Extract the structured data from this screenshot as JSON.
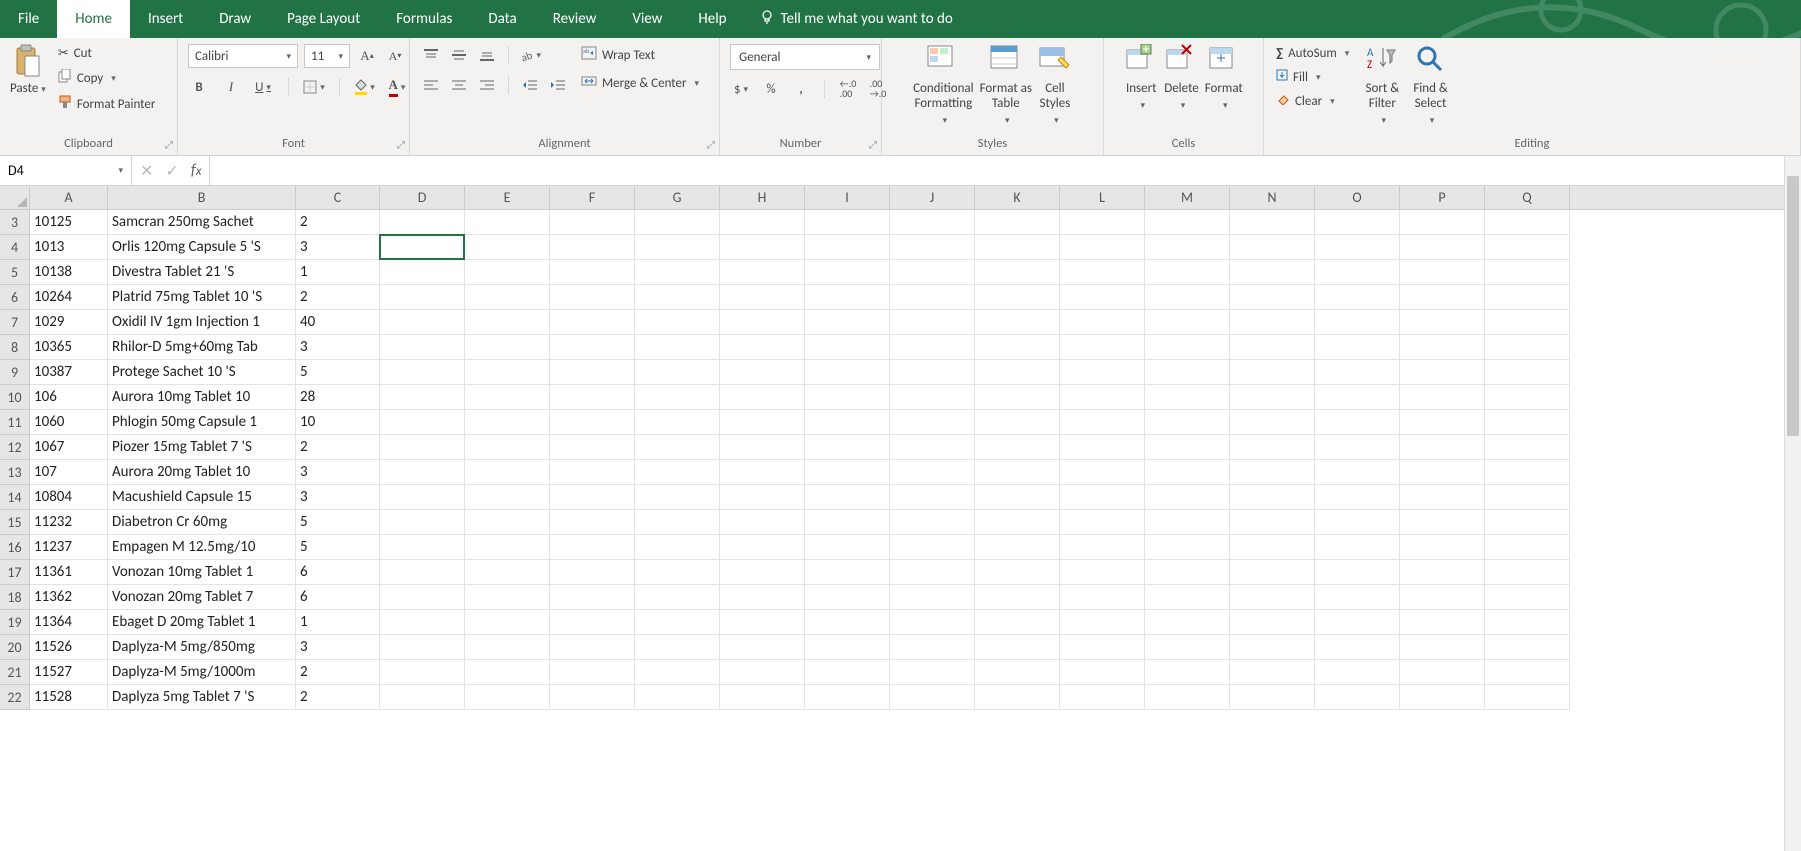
{
  "tabs": {
    "file": "File",
    "home": "Home",
    "insert": "Insert",
    "draw": "Draw",
    "page_layout": "Page Layout",
    "formulas": "Formulas",
    "data": "Data",
    "review": "Review",
    "view": "View",
    "help": "Help",
    "tellme": "Tell me what you want to do"
  },
  "ribbon": {
    "clipboard": {
      "paste": "Paste",
      "cut": "Cut",
      "copy": "Copy",
      "format_painter": "Format Painter",
      "label": "Clipboard"
    },
    "font": {
      "name": "Calibri",
      "size": "11",
      "label": "Font"
    },
    "alignment": {
      "wrap": "Wrap Text",
      "merge": "Merge & Center",
      "label": "Alignment"
    },
    "number": {
      "format": "General",
      "label": "Number"
    },
    "styles": {
      "cond": "Conditional\nFormatting",
      "table": "Format as\nTable",
      "cell": "Cell\nStyles",
      "label": "Styles"
    },
    "cells": {
      "insert": "Insert",
      "delete": "Delete",
      "format": "Format",
      "label": "Cells"
    },
    "editing": {
      "autosum": "AutoSum",
      "fill": "Fill",
      "clear": "Clear",
      "sort": "Sort &\nFilter",
      "find": "Find &\nSelect",
      "label": "Editing"
    }
  },
  "namebox": "D4",
  "formula": "",
  "columns": [
    "A",
    "B",
    "C",
    "D",
    "E",
    "F",
    "G",
    "H",
    "I",
    "J",
    "K",
    "L",
    "M",
    "N",
    "O",
    "P",
    "Q"
  ],
  "active_cell": "D4",
  "first_visible_row": 3,
  "rows": [
    {
      "n": 3,
      "a": "10125",
      "b": "Samcran 250mg Sachet",
      "c": "2"
    },
    {
      "n": 4,
      "a": "1013",
      "b": "Orlis 120mg Capsule 5 'S",
      "c": "3"
    },
    {
      "n": 5,
      "a": "10138",
      "b": "Divestra Tablet 21 'S",
      "c": "1"
    },
    {
      "n": 6,
      "a": "10264",
      "b": "Platrid 75mg Tablet 10 'S",
      "c": "2"
    },
    {
      "n": 7,
      "a": "1029",
      "b": "Oxidil IV 1gm Injection 1",
      "c": "40"
    },
    {
      "n": 8,
      "a": "10365",
      "b": "Rhilor-D 5mg+60mg Tab",
      "c": "3"
    },
    {
      "n": 9,
      "a": "10387",
      "b": "Protege Sachet 10 'S",
      "c": "5"
    },
    {
      "n": 10,
      "a": "106",
      "b": "Aurora 10mg Tablet 10",
      "c": "28"
    },
    {
      "n": 11,
      "a": "1060",
      "b": "Phlogin 50mg Capsule 1",
      "c": "10"
    },
    {
      "n": 12,
      "a": "1067",
      "b": "Piozer 15mg Tablet 7 'S",
      "c": "2"
    },
    {
      "n": 13,
      "a": "107",
      "b": "Aurora 20mg Tablet 10",
      "c": "3"
    },
    {
      "n": 14,
      "a": "10804",
      "b": "Macushield Capsule 15",
      "c": "3"
    },
    {
      "n": 15,
      "a": "11232",
      "b": "Diabetron Cr 60mg",
      "c": "5"
    },
    {
      "n": 16,
      "a": "11237",
      "b": "Empagen M 12.5mg/10",
      "c": "5"
    },
    {
      "n": 17,
      "a": "11361",
      "b": "Vonozan 10mg Tablet 1",
      "c": "6"
    },
    {
      "n": 18,
      "a": "11362",
      "b": "Vonozan 20mg Tablet 7",
      "c": "6"
    },
    {
      "n": 19,
      "a": "11364",
      "b": "Ebaget D 20mg Tablet 1",
      "c": "1"
    },
    {
      "n": 20,
      "a": "11526",
      "b": "Daplyza-M 5mg/850mg",
      "c": "3"
    },
    {
      "n": 21,
      "a": "11527",
      "b": "Daplyza-M 5mg/1000m",
      "c": "2"
    },
    {
      "n": 22,
      "a": "11528",
      "b": "Daplyza 5mg Tablet 7 'S",
      "c": "2"
    }
  ]
}
